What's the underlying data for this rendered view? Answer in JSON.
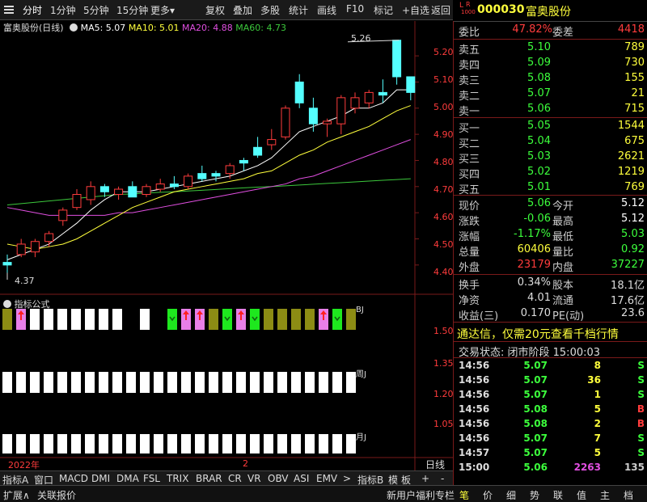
{
  "toolbar": {
    "left_items": [
      "分时",
      "1分钟",
      "5分钟",
      "15分钟",
      "更多"
    ],
    "selected": "分时",
    "more_arrow": "▾",
    "right_items": [
      "复权",
      "叠加",
      "多股",
      "统计",
      "画线",
      "F10",
      "标记",
      "+自选",
      "返回"
    ]
  },
  "header": {
    "code": "000030",
    "name": "富奥股份",
    "badge_r": "R",
    "badge_l": "L",
    "badge_sub": "1000"
  },
  "legend": {
    "stock": "富奥股份(日线)",
    "ma5": "MA5: 5.07",
    "ma10": "MA10: 5.01",
    "ma20": "MA20: 4.88",
    "ma60": "MA60: 4.73",
    "colors": {
      "ma5": "#ffffff",
      "ma10": "#ffff3c",
      "ma20": "#e14fe1",
      "ma60": "#3cc83c"
    }
  },
  "price_axis": [
    "5.20",
    "5.10",
    "5.00",
    "4.90",
    "4.80",
    "4.70",
    "4.60",
    "4.50",
    "4.40"
  ],
  "price_annotations": {
    "high": "5.26",
    "low": "4.37"
  },
  "indicator": {
    "title": "指标公式",
    "axis": [
      "1.50",
      "1.35",
      "1.20",
      "1.05"
    ],
    "row_labels": [
      "BJ",
      "周J",
      "月J"
    ]
  },
  "date_axis": {
    "left": "2022年",
    "mid": "2"
  },
  "chart_data": {
    "type": "candlestick",
    "candles": [
      {
        "o": 4.41,
        "h": 4.44,
        "l": 4.37,
        "c": 4.4
      },
      {
        "o": 4.44,
        "h": 4.5,
        "l": 4.43,
        "c": 4.48
      },
      {
        "o": 4.45,
        "h": 4.5,
        "l": 4.43,
        "c": 4.49
      },
      {
        "o": 4.49,
        "h": 4.53,
        "l": 4.47,
        "c": 4.52
      },
      {
        "o": 4.57,
        "h": 4.62,
        "l": 4.55,
        "c": 4.61
      },
      {
        "o": 4.62,
        "h": 4.69,
        "l": 4.61,
        "c": 4.67
      },
      {
        "o": 4.65,
        "h": 4.72,
        "l": 4.63,
        "c": 4.7
      },
      {
        "o": 4.7,
        "h": 4.71,
        "l": 4.66,
        "c": 4.68
      },
      {
        "o": 4.67,
        "h": 4.7,
        "l": 4.65,
        "c": 4.69
      },
      {
        "o": 4.7,
        "h": 4.72,
        "l": 4.67,
        "c": 4.66
      },
      {
        "o": 4.67,
        "h": 4.71,
        "l": 4.66,
        "c": 4.7
      },
      {
        "o": 4.69,
        "h": 4.73,
        "l": 4.68,
        "c": 4.71
      },
      {
        "o": 4.71,
        "h": 4.74,
        "l": 4.69,
        "c": 4.7
      },
      {
        "o": 4.7,
        "h": 4.75,
        "l": 4.69,
        "c": 4.74
      },
      {
        "o": 4.75,
        "h": 4.78,
        "l": 4.72,
        "c": 4.73
      },
      {
        "o": 4.75,
        "h": 4.76,
        "l": 4.72,
        "c": 4.74
      },
      {
        "o": 4.75,
        "h": 4.79,
        "l": 4.73,
        "c": 4.78
      },
      {
        "o": 4.8,
        "h": 4.81,
        "l": 4.76,
        "c": 4.79
      },
      {
        "o": 4.85,
        "h": 4.89,
        "l": 4.81,
        "c": 4.82
      },
      {
        "o": 4.86,
        "h": 4.92,
        "l": 4.84,
        "c": 4.88
      },
      {
        "o": 4.89,
        "h": 5.01,
        "l": 4.88,
        "c": 5.0
      },
      {
        "o": 5.1,
        "h": 5.13,
        "l": 5.0,
        "c": 5.02
      },
      {
        "o": 5.0,
        "h": 5.04,
        "l": 4.91,
        "c": 4.94
      },
      {
        "o": 4.94,
        "h": 4.96,
        "l": 4.89,
        "c": 4.95
      },
      {
        "o": 4.94,
        "h": 5.05,
        "l": 4.9,
        "c": 5.04
      },
      {
        "o": 5.0,
        "h": 5.06,
        "l": 4.98,
        "c": 5.04
      },
      {
        "o": 5.02,
        "h": 5.07,
        "l": 5.0,
        "c": 5.06
      },
      {
        "o": 5.06,
        "h": 5.11,
        "l": 5.02,
        "c": 5.05
      },
      {
        "o": 5.26,
        "h": 5.26,
        "l": 5.09,
        "c": 5.12
      },
      {
        "o": 5.12,
        "h": 5.12,
        "l": 5.03,
        "c": 5.06
      }
    ],
    "ma5": [
      4.42,
      4.44,
      4.46,
      4.48,
      4.52,
      4.56,
      4.61,
      4.65,
      4.68,
      4.68,
      4.68,
      4.69,
      4.7,
      4.71,
      4.72,
      4.73,
      4.74,
      4.76,
      4.78,
      4.81,
      4.86,
      4.91,
      4.93,
      4.95,
      4.97,
      5.0,
      5.0,
      5.02,
      5.07,
      5.07
    ],
    "ma10": [
      4.48,
      4.47,
      4.46,
      4.47,
      4.48,
      4.5,
      4.53,
      4.56,
      4.59,
      4.62,
      4.64,
      4.66,
      4.68,
      4.69,
      4.7,
      4.71,
      4.72,
      4.73,
      4.75,
      4.76,
      4.79,
      4.82,
      4.84,
      4.87,
      4.89,
      4.91,
      4.93,
      4.96,
      4.99,
      5.01
    ],
    "ma20": [
      4.62,
      4.61,
      4.6,
      4.59,
      4.59,
      4.59,
      4.59,
      4.59,
      4.6,
      4.6,
      4.61,
      4.62,
      4.63,
      4.64,
      4.65,
      4.66,
      4.67,
      4.68,
      4.69,
      4.7,
      4.71,
      4.73,
      4.74,
      4.76,
      4.78,
      4.8,
      4.82,
      4.84,
      4.86,
      4.88
    ],
    "ma60": [
      4.63,
      4.635,
      4.64,
      4.645,
      4.65,
      4.655,
      4.66,
      4.665,
      4.67,
      4.672,
      4.675,
      4.678,
      4.68,
      4.683,
      4.686,
      4.689,
      4.692,
      4.695,
      4.698,
      4.7,
      4.703,
      4.706,
      4.709,
      4.712,
      4.715,
      4.718,
      4.721,
      4.724,
      4.727,
      4.73
    ],
    "ylim": [
      4.35,
      5.29
    ],
    "indicator_bars": {
      "row1": [
        "olive",
        "pink",
        "white",
        "white",
        "white",
        "white",
        "white",
        "white",
        "white",
        "none",
        "white",
        "none",
        "green",
        "pink",
        "pink",
        "olive",
        "green",
        "pink",
        "green",
        "olive",
        "olive",
        "olive",
        "olive",
        "pink",
        "green",
        "olive"
      ],
      "row2_count": 26,
      "row3_count": 26
    }
  },
  "quote": {
    "weibi_label": "委比",
    "weibi_value": "47.82%",
    "weicha_label": "委差",
    "weicha_value": "4418",
    "sells": [
      {
        "label": "卖五",
        "price": "5.10",
        "vol": "789"
      },
      {
        "label": "卖四",
        "price": "5.09",
        "vol": "730"
      },
      {
        "label": "卖三",
        "price": "5.08",
        "vol": "155"
      },
      {
        "label": "卖二",
        "price": "5.07",
        "vol": "21"
      },
      {
        "label": "卖一",
        "price": "5.06",
        "vol": "715"
      }
    ],
    "buys": [
      {
        "label": "买一",
        "price": "5.05",
        "vol": "1544"
      },
      {
        "label": "买二",
        "price": "5.04",
        "vol": "675"
      },
      {
        "label": "买三",
        "price": "5.03",
        "vol": "2621"
      },
      {
        "label": "买四",
        "price": "5.02",
        "vol": "1219"
      },
      {
        "label": "买五",
        "price": "5.01",
        "vol": "769"
      }
    ],
    "stats": [
      {
        "l1": "现价",
        "v1": "5.06",
        "c1": "green",
        "l2": "今开",
        "v2": "5.12",
        "c2": "white"
      },
      {
        "l1": "涨跌",
        "v1": "-0.06",
        "c1": "green",
        "l2": "最高",
        "v2": "5.12",
        "c2": "white"
      },
      {
        "l1": "涨幅",
        "v1": "-1.17%",
        "c1": "green",
        "l2": "最低",
        "v2": "5.03",
        "c2": "green"
      },
      {
        "l1": "总量",
        "v1": "60406",
        "c1": "yellow",
        "l2": "量比",
        "v2": "0.92",
        "c2": "green"
      },
      {
        "l1": "外盘",
        "v1": "23179",
        "c1": "red",
        "l2": "内盘",
        "v2": "37227",
        "c2": "green"
      }
    ],
    "stats2": [
      {
        "l1": "换手",
        "v1": "0.34%",
        "l2": "股本",
        "v2": "18.1亿"
      },
      {
        "l1": "净资",
        "v1": "4.01",
        "l2": "流通",
        "v2": "17.6亿"
      },
      {
        "l1": "收益(三)",
        "v1": "0.170",
        "l2": "PE(动)",
        "v2": "23.6"
      }
    ],
    "promo": "通达信，仅需20元查看千档行情",
    "trade_status": "交易状态: 闭市阶段 15:00:03",
    "ticks": [
      {
        "t": "14:56",
        "p": "5.07",
        "v": "8",
        "d": "S"
      },
      {
        "t": "14:56",
        "p": "5.07",
        "v": "36",
        "d": "S"
      },
      {
        "t": "14:56",
        "p": "5.07",
        "v": "1",
        "d": "S"
      },
      {
        "t": "14:56",
        "p": "5.08",
        "v": "5",
        "d": "B"
      },
      {
        "t": "14:56",
        "p": "5.08",
        "v": "2",
        "d": "B"
      },
      {
        "t": "14:56",
        "p": "5.07",
        "v": "7",
        "d": "S"
      },
      {
        "t": "14:57",
        "p": "5.07",
        "v": "5",
        "d": "S"
      },
      {
        "t": "15:00",
        "p": "5.06",
        "v": "2263",
        "d": "135"
      }
    ]
  },
  "bottom_tabs": [
    "指标A",
    "窗口",
    "MACD",
    "DMI",
    "DMA",
    "FSL",
    "TRIX",
    "BRAR",
    "CR",
    "VR",
    "OBV",
    "ASI",
    "EMV",
    ">",
    "指标B",
    "模",
    "板",
    "+",
    "-"
  ],
  "bottom_right": "日线",
  "status": {
    "left": [
      "扩展∧",
      "关联报价"
    ],
    "mid": "新用户福利专栏",
    "right_tabs": [
      "笔",
      "价",
      "细",
      "势",
      "联",
      "值",
      "主",
      "档"
    ]
  }
}
